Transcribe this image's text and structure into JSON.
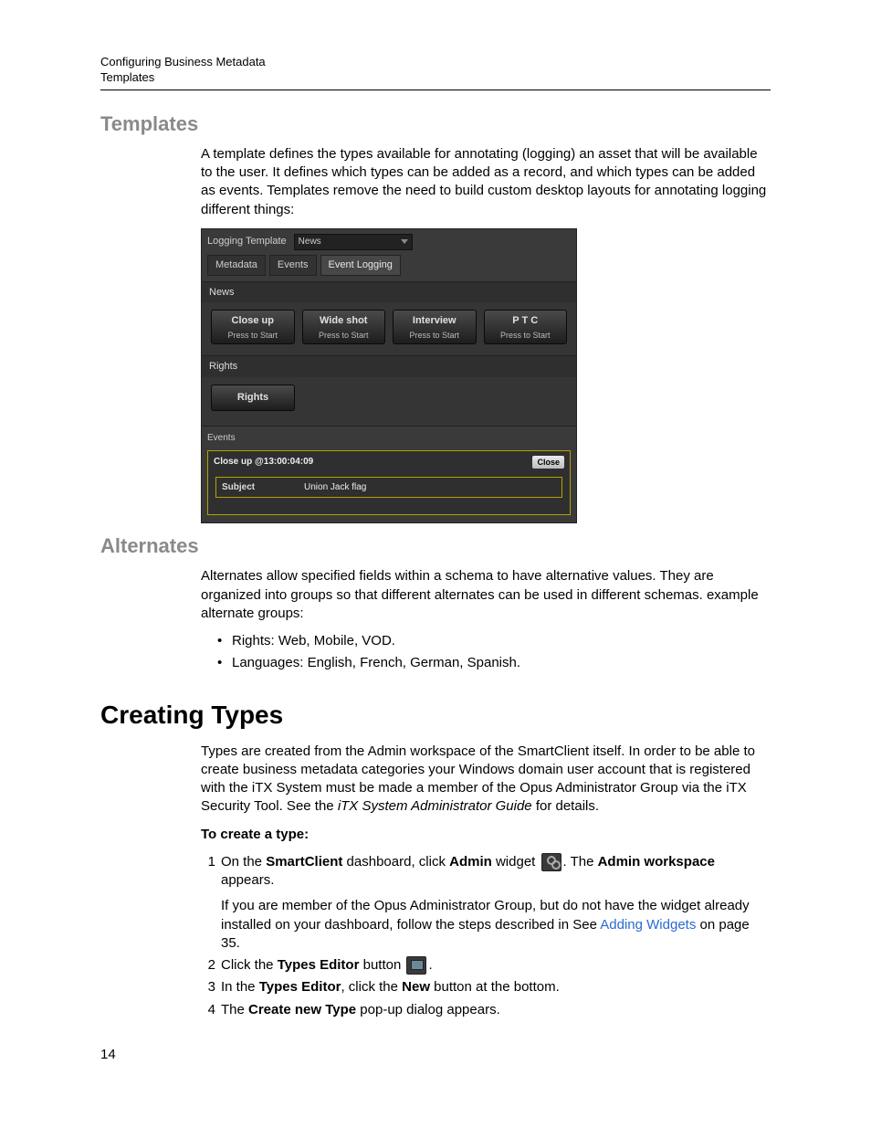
{
  "header": {
    "line1": "Configuring Business Metadata",
    "line2": "Templates"
  },
  "templates": {
    "heading": "Templates",
    "paragraph": "A template defines the types available for annotating (logging) an asset that will be available to the user. It defines which types can be added as a record, and which types can be added as events. Templates remove the need to build custom desktop layouts for annotating logging different things:"
  },
  "shot": {
    "logging_template_label": "Logging Template",
    "dropdown_value": "News",
    "tabs": {
      "metadata": "Metadata",
      "events": "Events",
      "event_logging": "Event Logging"
    },
    "section_news": "News",
    "buttons": [
      {
        "title": "Close up",
        "sub": "Press to Start"
      },
      {
        "title": "Wide shot",
        "sub": "Press to Start"
      },
      {
        "title": "Interview",
        "sub": "Press to Start"
      },
      {
        "title": "P T C",
        "sub": "Press to Start"
      }
    ],
    "section_rights": "Rights",
    "rights_button": "Rights",
    "events_label": "Events",
    "event_title": "Close up @13:00:04:09",
    "event_close": "Close",
    "event_field_label": "Subject",
    "event_field_value": "Union Jack flag"
  },
  "alternates": {
    "heading": "Alternates",
    "paragraph": "Alternates allow specified fields within a schema to have alternative values. They are organized into groups so that different alternates can be used in different schemas. example alternate groups:",
    "bullets": [
      "Rights: Web, Mobile, VOD.",
      "Languages: English, French, German, Spanish."
    ]
  },
  "creating_types": {
    "heading": "Creating Types",
    "paragraph": "Types are created from the Admin workspace of the SmartClient itself. In order to be able to create business metadata categories your Windows domain user account that is registered with the iTX System must be made a member of the Opus Administrator Group via the iTX Security Tool. See the ",
    "guide_name": "iTX System Administrator Guide",
    "paragraph_tail": " for details.",
    "procedure_heading": "To create a type:",
    "step1_a": "On the ",
    "step1_b": "SmartClient",
    "step1_c": " dashboard, click ",
    "step1_d": "Admin",
    "step1_e": " widget ",
    "step1_f": ". The ",
    "step1_g": "Admin workspace",
    "step1_h": " appears.",
    "step1_note_a": "If you are member of the Opus Administrator Group, but do not have the widget already installed on your dashboard, follow the steps described in See ",
    "step1_link": "Adding Widgets",
    "step1_note_b": " on page 35.",
    "step2_a": "Click the ",
    "step2_b": "Types Editor",
    "step2_c": " button ",
    "step2_d": ".",
    "step3_a": "In the ",
    "step3_b": "Types Editor",
    "step3_c": ", click the ",
    "step3_d": "New",
    "step3_e": " button at the bottom.",
    "step4_a": "The ",
    "step4_b": "Create new Type",
    "step4_c": " pop-up dialog appears."
  },
  "page_number": "14"
}
